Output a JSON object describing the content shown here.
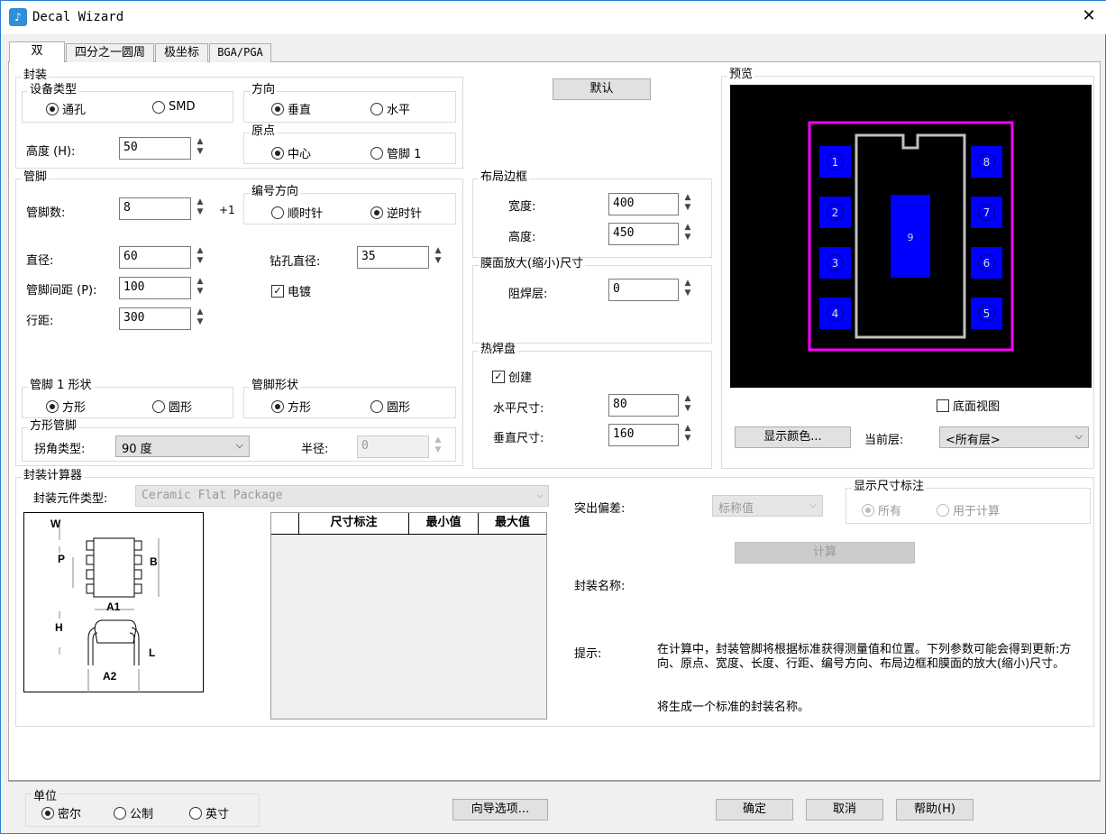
{
  "window": {
    "title": "Decal Wizard",
    "close": "✕"
  },
  "tabs": [
    "双",
    "四分之一圆周",
    "极坐标",
    "BGA/PGA"
  ],
  "package": {
    "title": "封装",
    "device_type": {
      "title": "设备类型",
      "options": [
        "通孔",
        "SMD"
      ],
      "selected": "通孔"
    },
    "direction": {
      "title": "方向",
      "options": [
        "垂直",
        "水平"
      ],
      "selected": "垂直"
    },
    "origin": {
      "title": "原点",
      "options": [
        "中心",
        "管脚 1"
      ],
      "selected": "中心"
    },
    "height_label": "高度 (H):",
    "height_value": "50"
  },
  "default_button": "默认",
  "pins": {
    "title": "管脚",
    "count_label": "管脚数:",
    "count_value": "8",
    "plus_one": "+1",
    "numbering": {
      "title": "编号方向",
      "options": [
        "顺时针",
        "逆时针"
      ],
      "selected": "逆时针"
    },
    "diameter_label": "直径:",
    "diameter_value": "60",
    "drill_label": "钻孔直径:",
    "drill_value": "35",
    "pitch_label": "管脚间距 (P):",
    "pitch_value": "100",
    "plated_label": "电镀",
    "plated": true,
    "row_label": "行距:",
    "row_value": "300",
    "pin1_shape": {
      "title": "管脚 1 形状",
      "options": [
        "方形",
        "圆形"
      ],
      "selected": "方形"
    },
    "pin_shape": {
      "title": "管脚形状",
      "options": [
        "方形",
        "圆形"
      ],
      "selected": "方形"
    },
    "square_pin": {
      "title": "方形管脚",
      "corner_label": "拐角类型:",
      "corner_value": "90 度",
      "radius_label": "半径:",
      "radius_value": "0"
    }
  },
  "outline": {
    "title": "布局边框",
    "width_label": "宽度:",
    "width_value": "400",
    "height_label": "高度:",
    "height_value": "450"
  },
  "mask": {
    "title": "膜面放大(缩小)尺寸",
    "solder_label": "阻焊层:",
    "solder_value": "0"
  },
  "thermal": {
    "title": "热焊盘",
    "create_label": "创建",
    "create": true,
    "h_label": "水平尺寸:",
    "h_value": "80",
    "v_label": "垂直尺寸:",
    "v_value": "160"
  },
  "preview": {
    "title": "预览",
    "pads_left": [
      "1",
      "2",
      "3",
      "4"
    ],
    "pads_right": [
      "8",
      "7",
      "6",
      "5"
    ],
    "center_pad": "9",
    "bottom_view_label": "底面视图",
    "colors_button": "显示颜色...",
    "layer_label": "当前层:",
    "layer_value": "<所有层>",
    "colors": {
      "outline": "#ff00ff",
      "body": "#c0c0c0",
      "pad": "#0000ff"
    }
  },
  "calculator": {
    "title": "封装计算器",
    "type_label": "封装元件类型:",
    "type_value": "Ceramic Flat Package",
    "table_headers": [
      "",
      "尺寸标注",
      "最小值",
      "最大值"
    ],
    "tolerance_label": "突出偏差:",
    "tolerance_value": "标称值",
    "show_dims": {
      "title": "显示尺寸标注",
      "options": [
        "所有",
        "用于计算"
      ],
      "selected": "所有"
    },
    "calc_button": "计算",
    "name_label": "封装名称:",
    "hint_label": "提示:",
    "hint_text": "在计算中，封装管脚将根据标准获得测量值和位置。下列参数可能会得到更新:方向、原点、宽度、长度、行距、编号方向、布局边框和膜面的放大(缩小)尺寸。",
    "hint_text2": "将生成一个标准的封装名称。",
    "diagram_labels": [
      "W",
      "P",
      "B",
      "A1",
      "H",
      "L",
      "A2"
    ]
  },
  "units": {
    "title": "单位",
    "options": [
      "密尔",
      "公制",
      "英寸"
    ],
    "selected": "密尔"
  },
  "buttons": {
    "wizard_options": "向导选项...",
    "ok": "确定",
    "cancel": "取消",
    "help": "帮助(H)"
  }
}
